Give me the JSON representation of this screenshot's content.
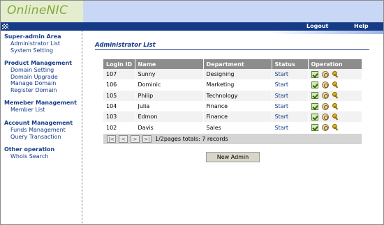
{
  "header": {
    "logo": "OnlineNIC"
  },
  "navbar": {
    "logout": "Logout",
    "help": "Help"
  },
  "sidebar": {
    "groups": [
      {
        "title": "Super-admin Area",
        "items": [
          "Administrator List",
          "System Setting"
        ]
      },
      {
        "title": "Product Management",
        "items": [
          "Domain Setting",
          "Domain Upgrade",
          "Manage Domain",
          "Register Domain"
        ]
      },
      {
        "title": "Memeber Management",
        "items": [
          "Member List"
        ]
      },
      {
        "title": "Account Management",
        "items": [
          "Funds Management",
          "Query Transaction"
        ]
      },
      {
        "title": "Other operation",
        "items": [
          "Whois Search"
        ]
      }
    ]
  },
  "main": {
    "title": "Administrator List",
    "table": {
      "headers": [
        "Login ID",
        "Name",
        "Department",
        "Status",
        "Operation"
      ],
      "rows": [
        {
          "id": "107",
          "name": "Sunny",
          "department": "Designing",
          "status": "Start"
        },
        {
          "id": "106",
          "name": "Dominic",
          "department": "Marketing",
          "status": "Start"
        },
        {
          "id": "105",
          "name": "Philip",
          "department": "Technology",
          "status": "Start"
        },
        {
          "id": "104",
          "name": "Julia",
          "department": "Finance",
          "status": "Start"
        },
        {
          "id": "103",
          "name": "Edmon",
          "department": "Finance",
          "status": "Start"
        },
        {
          "id": "102",
          "name": "Davis",
          "department": "Sales",
          "status": "Start"
        }
      ],
      "operation_icons": [
        "edit-icon",
        "disable-icon",
        "key-icon"
      ]
    },
    "pager": {
      "buttons": [
        "|<",
        "<",
        ">",
        ">|"
      ],
      "info": "1/2pages totals: 7 records"
    },
    "new_admin_button": "New Admin"
  },
  "colors": {
    "brand_green": "#85a83a",
    "logo_bg": "#e4eecf",
    "header_blue": "#c9d7f7",
    "navbar": "#153b87",
    "table_header": "#8c8c8c"
  }
}
